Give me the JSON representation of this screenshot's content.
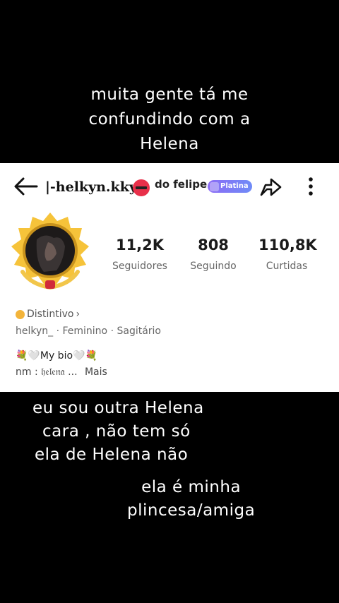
{
  "captions": {
    "top": [
      "muita gente tá me",
      "confundindo com a",
      "Helena"
    ],
    "middle": [
      "eu sou outra Helena",
      "cara , não tem só",
      "ela de Helena não"
    ],
    "bottom": [
      "ela é minha",
      "plincesa/amiga"
    ]
  },
  "profile": {
    "username": "|-helkyn.kky",
    "nickname_suffix": "do felipe",
    "badge_label": "Platina",
    "stats": [
      {
        "value": "11,2K",
        "label": "Seguidores"
      },
      {
        "value": "808",
        "label": "Seguindo"
      },
      {
        "value": "110,8K",
        "label": "Curtidas"
      }
    ],
    "distintivo": "Distintivo",
    "distintivo_arrow": "›",
    "meta": "helkyn_  ·  Feminino  ·  Sagitário",
    "bio_line1": "💐🤍My bio🤍💐",
    "bio_line2": "nm : 𝔥𝔢𝔩𝔢𝔫𝔞 ...",
    "more_label": "Mais"
  },
  "colors": {
    "background": "#000000",
    "panel": "#ffffff",
    "badge": "#7c7cf6",
    "accent_red": "#e8304a"
  },
  "icons": [
    "back-arrow-icon",
    "no-smoking-icon",
    "share-icon",
    "more-vertical-icon",
    "distintivo-icon"
  ]
}
